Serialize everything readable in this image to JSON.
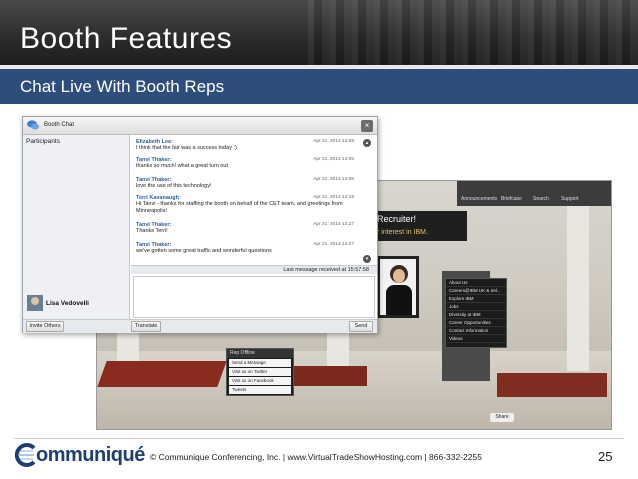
{
  "slide": {
    "title": "Booth Features",
    "subtitle": "Chat Live With Booth Reps",
    "page_number": "25"
  },
  "footer": {
    "company": "ommuniqué",
    "text": "© Communique Conferencing, Inc.  |  www.VirtualTradeShowHosting.com  |  866-332-2255"
  },
  "chat": {
    "window_title": "Booth Chat",
    "participants_label": "Participants",
    "participant": "Lisa Vedovelli",
    "invite_button": "Invite Others",
    "translate_button": "Translate",
    "send_button": "Send",
    "status": "Last message received at 15:57:58",
    "messages": [
      {
        "from": "Elizabeth Lee:",
        "time": "Apr 21, 2014 13:58",
        "lines": [
          "I think that the fair was a success today :)"
        ]
      },
      {
        "from": "Tanvi Thaker:",
        "time": "Apr 21, 2014 14:06",
        "lines": [
          "thanks so much! what a great turn out"
        ]
      },
      {
        "from": "Tanvi Thaker:",
        "time": "Apr 21, 2014 14:06",
        "lines": [
          "love the use of this technology!"
        ]
      },
      {
        "from": "Terri Kavanaugh:",
        "time": "Apr 21, 2014 14:19",
        "lines": [
          "Hi Tanvi - thanks for staffing the booth on behalf of the CET team, and greetings from",
          "Minneapolis!"
        ]
      },
      {
        "from": "Tanvi Thaker:",
        "time": "Apr 21, 2014 14:27",
        "lines": [
          "Thanks Terri!"
        ]
      },
      {
        "from": "Tanvi Thaker:",
        "time": "Apr 21, 2014 14:27",
        "lines": [
          "we've gotten some great traffic and wonderful questions"
        ]
      }
    ]
  },
  "booth": {
    "banner_line1": "Recruiter!",
    "banner_line2": "r interest in IBM.",
    "topbar_items": [
      "Announcements",
      "Briefcase",
      "Search",
      "Support"
    ],
    "menu_items": [
      "About Us",
      "Careers@IBM UK & Irel...",
      "Explore IBM",
      "Jobs",
      "Diversity at IBM",
      "Career Opportunities",
      "Contact Information",
      "Videos"
    ],
    "rep_menu_header": "Rep Offline",
    "rep_menu_items": [
      "Send a Message",
      "Visit us on Twitter",
      "Visit us on Facebook",
      "Tweets"
    ],
    "share_label": "Share"
  }
}
